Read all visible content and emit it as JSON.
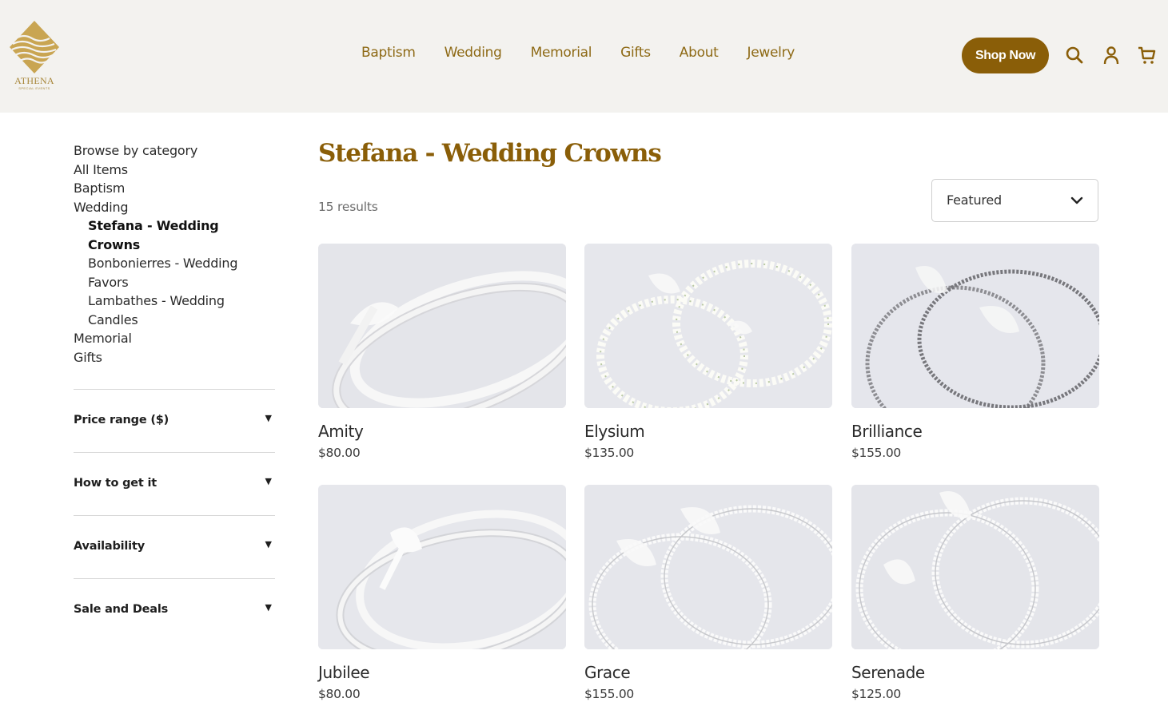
{
  "header": {
    "logo_text": "ATHENA",
    "logo_subtext": "SPECIAL EVENTS",
    "nav": [
      "Baptism",
      "Wedding",
      "Memorial",
      "Gifts",
      "About",
      "Jewelry"
    ],
    "shop_button": "Shop Now",
    "icons": [
      "search-icon",
      "account-icon",
      "cart-icon"
    ]
  },
  "sidebar": {
    "heading": "Browse by category",
    "categories": {
      "all": "All Items",
      "baptism": "Baptism",
      "wedding": "Wedding",
      "sub": [
        "Stefana - Wedding Crowns",
        "Bonbonierres - Wedding Favors",
        "Lambathes - Wedding Candles"
      ],
      "memorial": "Memorial",
      "gifts": "Gifts"
    },
    "filters": [
      "Price range ($)",
      "How to get it",
      "Availability",
      "Sale and Deals"
    ]
  },
  "main": {
    "title": "Stefana - Wedding Crowns",
    "results": "15 results",
    "sort_value": "Featured",
    "products": [
      {
        "name": "Amity",
        "price": "$80.00"
      },
      {
        "name": "Elysium",
        "price": "$135.00"
      },
      {
        "name": "Brilliance",
        "price": "$155.00"
      },
      {
        "name": "Jubilee",
        "price": "$80.00"
      },
      {
        "name": "Grace",
        "price": "$155.00"
      },
      {
        "name": "Serenade",
        "price": "$125.00"
      }
    ]
  },
  "colors": {
    "header_bg": "#f3f2ef",
    "accent": "#8a5e08",
    "nav_text": "#8e6a16",
    "logo_gold": "#a8873a"
  }
}
